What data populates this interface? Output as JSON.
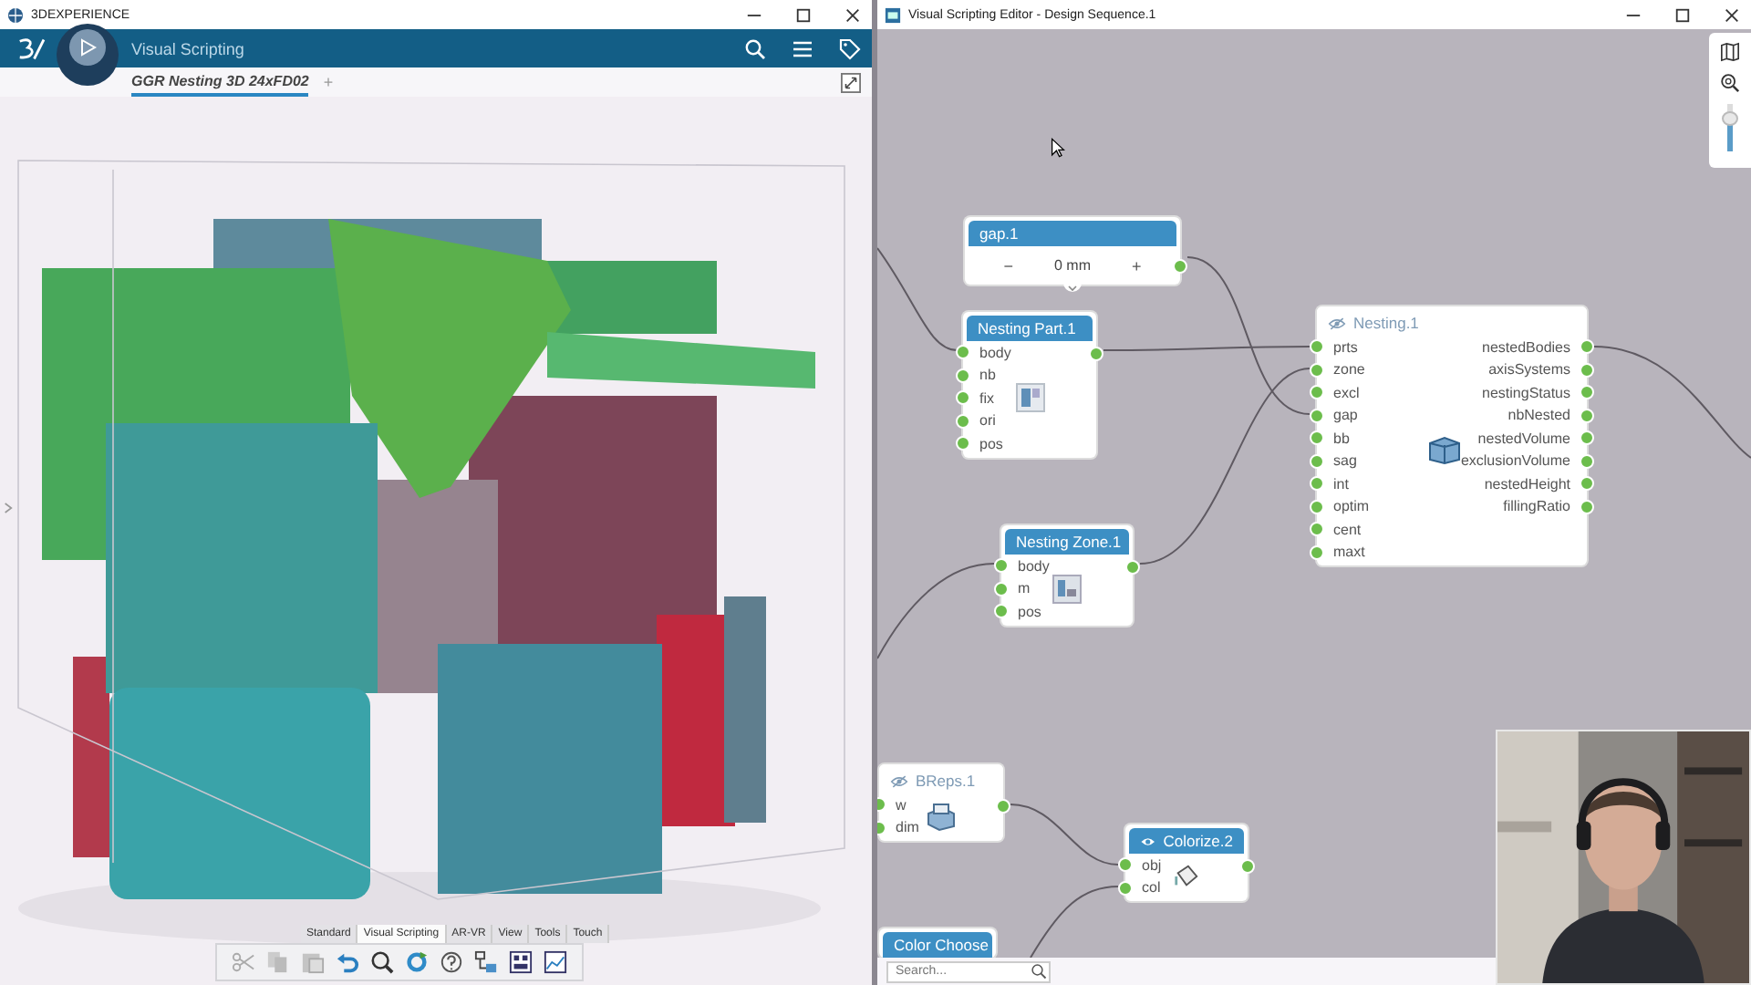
{
  "app_window": {
    "title": "3DEXPERIENCE",
    "app_name": "Visual Scripting",
    "tabs": [
      {
        "label": "GGR Nesting 3D 24xFD02",
        "selected": true
      }
    ],
    "add_tab": "+",
    "toolbar_tabs": [
      {
        "label": "Standard",
        "selected": false
      },
      {
        "label": "Visual Scripting",
        "selected": true
      },
      {
        "label": "AR-VR",
        "selected": false
      },
      {
        "label": "View",
        "selected": false
      },
      {
        "label": "Tools",
        "selected": false
      },
      {
        "label": "Touch",
        "selected": false
      }
    ]
  },
  "editor_window": {
    "title": "Visual Scripting Editor - Design Sequence.1",
    "nodes": [
      {
        "kind": "parameter",
        "title": "gap.1",
        "filled_header": true,
        "decrement": "−",
        "value": "0 mm",
        "increment": "+",
        "has_output": true
      },
      {
        "kind": "part",
        "title": "Nesting Part.1",
        "filled_header": true,
        "has_output": true,
        "inputs": [
          "body",
          "nb",
          "fix",
          "ori",
          "pos"
        ]
      },
      {
        "kind": "zone",
        "title": "Nesting Zone.1",
        "filled_header": true,
        "has_output": true,
        "inputs": [
          "body",
          "m",
          "pos"
        ]
      },
      {
        "kind": "nesting",
        "title": "Nesting.1",
        "filled_header": false,
        "visible": false,
        "inputs": [
          "prts",
          "zone",
          "excl",
          "gap",
          "bb",
          "sag",
          "int",
          "optim",
          "cent",
          "maxt"
        ],
        "outputs": [
          "nestedBodies",
          "axisSystems",
          "nestingStatus",
          "nbNested",
          "nestedVolume",
          "exclusionVolume",
          "nestedHeight",
          "fillingRatio"
        ]
      },
      {
        "kind": "breps",
        "title": "BReps.1",
        "filled_header": false,
        "visible": false,
        "has_output": true,
        "inputs": [
          "w",
          "dim"
        ]
      },
      {
        "kind": "colorize",
        "title": "Colorize.2",
        "filled_header": true,
        "visible": true,
        "has_output": true,
        "inputs": [
          "obj",
          "col"
        ]
      },
      {
        "kind": "color_chooser",
        "title": "Color Choose",
        "filled_header": true
      }
    ],
    "zoom_slider": {
      "level": 0.7
    },
    "search": {
      "placeholder": "Search..."
    }
  }
}
